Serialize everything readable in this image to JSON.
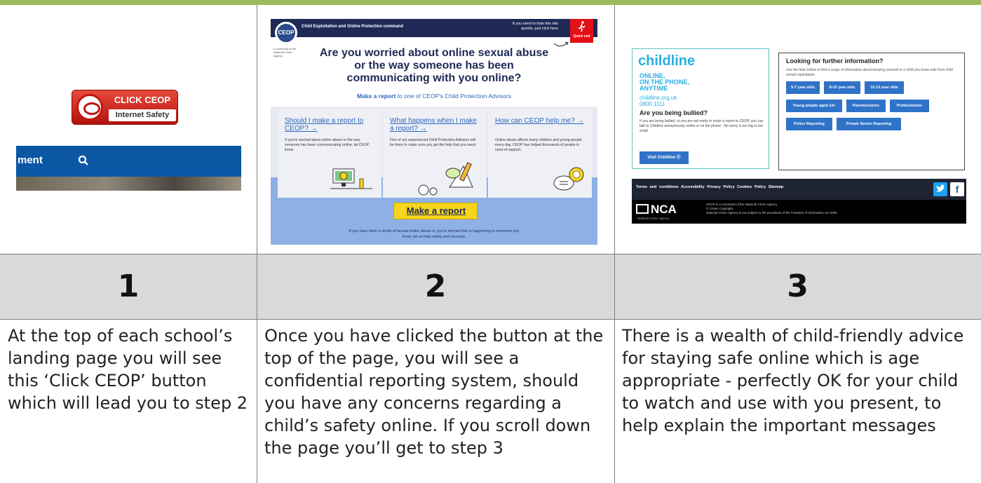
{
  "steps": [
    {
      "number": "1",
      "description": "At the top of each school’s landing page you will see this ‘Click CEOP’ button which will lead you to step 2"
    },
    {
      "number": "2",
      "description": "Once you have clicked the button at the top of the page, you will see a confidential reporting system, should you have any concerns regarding a child’s safety online.  If you scroll down the page you’ll get to step 3"
    },
    {
      "number": "3",
      "description": "There is a wealth of child-friendly advice for staying safe online which is age appropriate - perfectly OK for your child to watch and use with you present, to help explain the important messages"
    }
  ],
  "panel1": {
    "button_title": "CLICK CEOP",
    "button_subtitle": "Internet Safety",
    "nav_text": "ment",
    "icons": {
      "search": "search-icon",
      "logo": "ceop-logo-icon"
    }
  },
  "panel2": {
    "header_title": "Child Exploitation and Online Protection command",
    "logo_text": "CEOP",
    "logo_caption": "A command of the National Crime Agency",
    "hide_text": "If you need to hide this site quickly, just click here",
    "quick_exit": "Quick exit",
    "headline": "Are you worried about online sexual abuse or the way someone has been communicating with you online?",
    "subhead_link": "Make a report",
    "subhead_rest": " to one of CEOP's Child Protection Advisors",
    "cards": [
      {
        "title": "Should I make a report to CEOP? →",
        "body": "If you're worried about online abuse or the way someone has been communicating online, let CEOP know."
      },
      {
        "title": "What happens when I make a report? →",
        "body": "One of our experienced Child Protection Advisors will be there to make sure you get the help that you need."
      },
      {
        "title": "How can CEOP help me? →",
        "body": "Online abuse affects many children and young people every day, CEOP has helped thousands of people in need of support."
      }
    ],
    "report_button": "Make a report",
    "footer_text": "If you have been a victim of sexual online abuse or you're worried this is happening to someone you know, let us help safely and securely."
  },
  "panel3": {
    "childline": {
      "logo": "childline",
      "tagline": [
        "ONLINE,",
        "ON THE PHONE,",
        "ANYTIME"
      ],
      "url": "childline.org.uk",
      "phone": "0800 1111",
      "question": "Are you being bullied?",
      "body": "If you are being bullied, or you are not ready to make a report to CEOP, you can talk to Childline anonymously online or on the phone - No worry is too big or too small.",
      "button": "Visit Childline ⦿"
    },
    "info": {
      "title": "Looking for further information?",
      "body": "Use the links below to find a range of information about keeping yourself or a child you know safe from child sexual exploitation",
      "chips": [
        "5-7 year olds",
        "8-10 year olds",
        "11-13 year olds",
        "Young people aged 14+",
        "Parents/carers",
        "Professionals",
        "Police Reporting",
        "Private Sector Reporting"
      ]
    },
    "footer_links": "Terms and conditions  Accessibility  Privacy Policy  Cookies Policy  Sitemap",
    "nca_logo": "NCA",
    "nca_subtitle": "National Crime Agency",
    "nca_legal": [
      "CEOP is a command of the National Crime Agency",
      "© Crown Copyright",
      "National Crime Agency is not subject to the provisions of the Freedom of Information Act 2000"
    ],
    "social": {
      "twitter": "twitter-icon",
      "facebook": "f"
    }
  },
  "colors": {
    "top_bar": "#9bbb59",
    "number_band": "#d9d9d9",
    "ceop_red": "#c2150f",
    "ceop_navy": "#1e2a55",
    "ceop_link_blue": "#2e66b8",
    "report_yellow": "#f7d51d",
    "childline_cyan": "#27aee0"
  }
}
